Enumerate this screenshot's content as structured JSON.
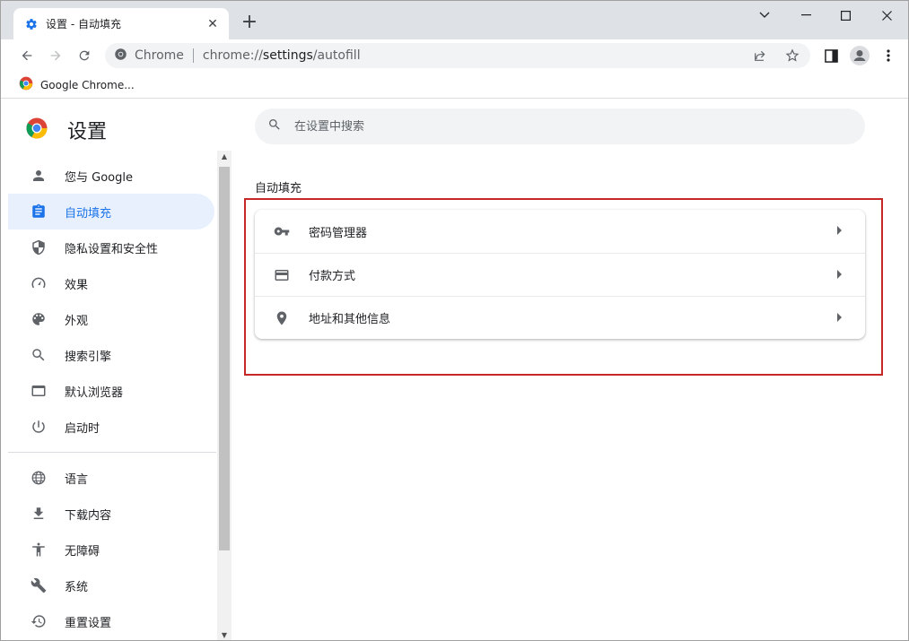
{
  "browser": {
    "tab_title": "设置 - 自动填充",
    "new_tab_label": "+",
    "site_label": "Chrome",
    "url_host": "chrome://",
    "url_host_bold": "settings",
    "url_path": "/autofill",
    "bookmark_label": "Google Chrome..."
  },
  "settings": {
    "title": "设置",
    "search_placeholder": "在设置中搜索",
    "nav_primary": [
      {
        "label": "您与 Google",
        "icon": "person-icon"
      },
      {
        "label": "自动填充",
        "icon": "clipboard-icon",
        "active": true
      },
      {
        "label": "隐私设置和安全性",
        "icon": "shield-icon"
      },
      {
        "label": "效果",
        "icon": "gauge-icon"
      },
      {
        "label": "外观",
        "icon": "palette-icon"
      },
      {
        "label": "搜索引擎",
        "icon": "search-icon"
      },
      {
        "label": "默认浏览器",
        "icon": "browser-window-icon"
      },
      {
        "label": "启动时",
        "icon": "power-icon"
      }
    ],
    "nav_secondary": [
      {
        "label": "语言",
        "icon": "globe-icon"
      },
      {
        "label": "下载内容",
        "icon": "download-icon"
      },
      {
        "label": "无障碍",
        "icon": "accessibility-icon"
      },
      {
        "label": "系统",
        "icon": "wrench-icon"
      },
      {
        "label": "重置设置",
        "icon": "history-icon"
      }
    ],
    "section_title": "自动填充",
    "rows": [
      {
        "label": "密码管理器",
        "icon": "key-icon"
      },
      {
        "label": "付款方式",
        "icon": "credit-card-icon"
      },
      {
        "label": "地址和其他信息",
        "icon": "location-pin-icon"
      }
    ]
  },
  "colors": {
    "accent": "#1a73e8",
    "active_bg": "#e8f0fe",
    "highlight_border": "#c62828"
  }
}
